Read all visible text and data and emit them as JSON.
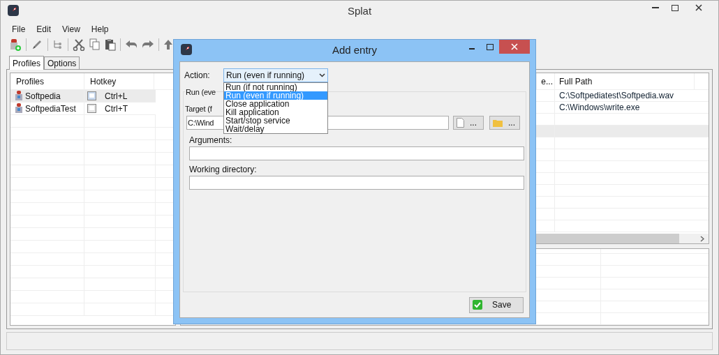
{
  "window": {
    "title": "Splat"
  },
  "menu": [
    "File",
    "Edit",
    "View",
    "Help"
  ],
  "tabs": [
    {
      "label": "Profiles",
      "selected": true
    },
    {
      "label": "Options",
      "selected": false
    }
  ],
  "profiles": {
    "columns": [
      "Profiles",
      "Hotkey"
    ],
    "rows": [
      {
        "name": "Softpedia",
        "hotkey": "Ctrl+L",
        "selected": true
      },
      {
        "name": "SoftpediaTest",
        "hotkey": "Ctrl+T",
        "selected": false
      }
    ]
  },
  "entries": {
    "columns": [
      "e...",
      "Full Path"
    ],
    "rows": [
      {
        "full_path": "C:\\Softpediatest\\Softpedia.wav",
        "selected": false
      },
      {
        "full_path": "C:\\Windows\\write.exe",
        "selected": false
      },
      {
        "selected": false
      },
      {
        "selected": true
      }
    ]
  },
  "dialog": {
    "title": "Add entry",
    "action": {
      "label": "Action:",
      "value": "Run (even if running)",
      "expanded": true,
      "options": [
        {
          "label": "Run (if not running)",
          "selected": false
        },
        {
          "label": "Run (even if running)",
          "selected": true
        },
        {
          "label": "Close application",
          "selected": false
        },
        {
          "label": "Kill application",
          "selected": false
        },
        {
          "label": "Start/stop service",
          "selected": false
        },
        {
          "label": "Wait/delay",
          "selected": false
        }
      ]
    },
    "group_title": "Run (eve",
    "target_label": "Target (f",
    "target_value": "C:\\Wind",
    "browse_buttons": [
      {
        "kind": "file",
        "label": "..."
      },
      {
        "kind": "folder",
        "label": "..."
      }
    ],
    "arguments_label": "Arguments:",
    "working_dir_label": "Working directory:",
    "save": "Save"
  }
}
